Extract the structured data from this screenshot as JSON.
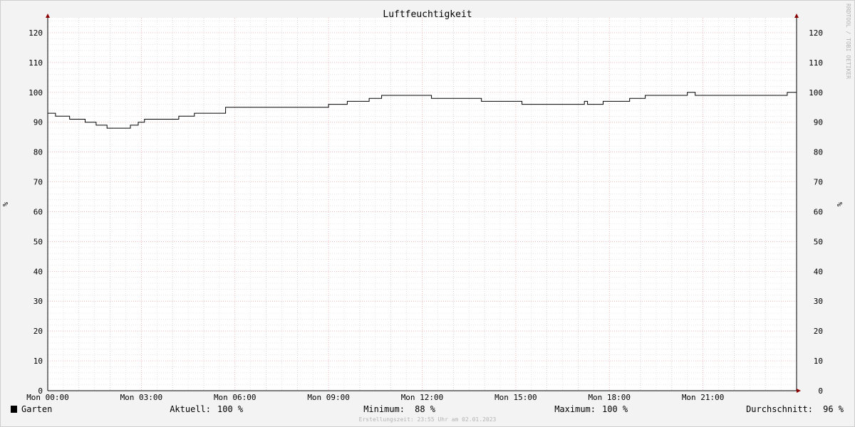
{
  "watermark": "RRDTOOL / TOBI OETIKER",
  "chart_data": {
    "type": "line",
    "title": "Luftfeuchtigkeit",
    "ylabel_left": "%",
    "ylabel_right": "%",
    "ylim": [
      0,
      125
    ],
    "y_ticks": [
      0,
      10,
      20,
      30,
      40,
      50,
      60,
      70,
      80,
      90,
      100,
      110,
      120
    ],
    "y_tick_labels": [
      "0",
      "10",
      "20",
      "30",
      "40",
      "50",
      "60",
      "70",
      "80",
      "90",
      "100",
      "110",
      "120"
    ],
    "xlim": [
      0,
      24
    ],
    "x_ticks": [
      0,
      3,
      6,
      9,
      12,
      15,
      18,
      21
    ],
    "x_tick_labels": [
      "Mon 00:00",
      "Mon 03:00",
      "Mon 06:00",
      "Mon 09:00",
      "Mon 12:00",
      "Mon 15:00",
      "Mon 18:00",
      "Mon 21:00"
    ],
    "grid": true,
    "legend": "bottom-left",
    "series": [
      {
        "name": "Garten",
        "color": "#000000",
        "x": [
          0,
          0.25,
          0.7,
          1.2,
          1.55,
          1.9,
          2.65,
          2.9,
          3.1,
          4.2,
          4.7,
          5.7,
          9.0,
          9.6,
          10.3,
          10.7,
          12.3,
          13.9,
          15.2,
          17.2,
          17.3,
          17.8,
          18.65,
          19.15,
          20.5,
          20.75,
          23.7,
          24.0
        ],
        "values": [
          93,
          92,
          91,
          90,
          89,
          88,
          89,
          90,
          91,
          92,
          93,
          95,
          96,
          97,
          98,
          99,
          98,
          97,
          96,
          97,
          96,
          97,
          98,
          99,
          100,
          99,
          100,
          100
        ]
      }
    ]
  },
  "legend": {
    "series_name": "Garten",
    "swatch_color": "#000000",
    "current_label": "Aktuell:",
    "current_value": "100 %",
    "min_label": "Minimum:",
    "min_value": "88 %",
    "max_label": "Maximum:",
    "max_value": "100 %",
    "avg_label": "Durchschnitt:",
    "avg_value": "96 %"
  },
  "footer": "Erstellungszeit: 23:55 Uhr am 02.01.2023"
}
